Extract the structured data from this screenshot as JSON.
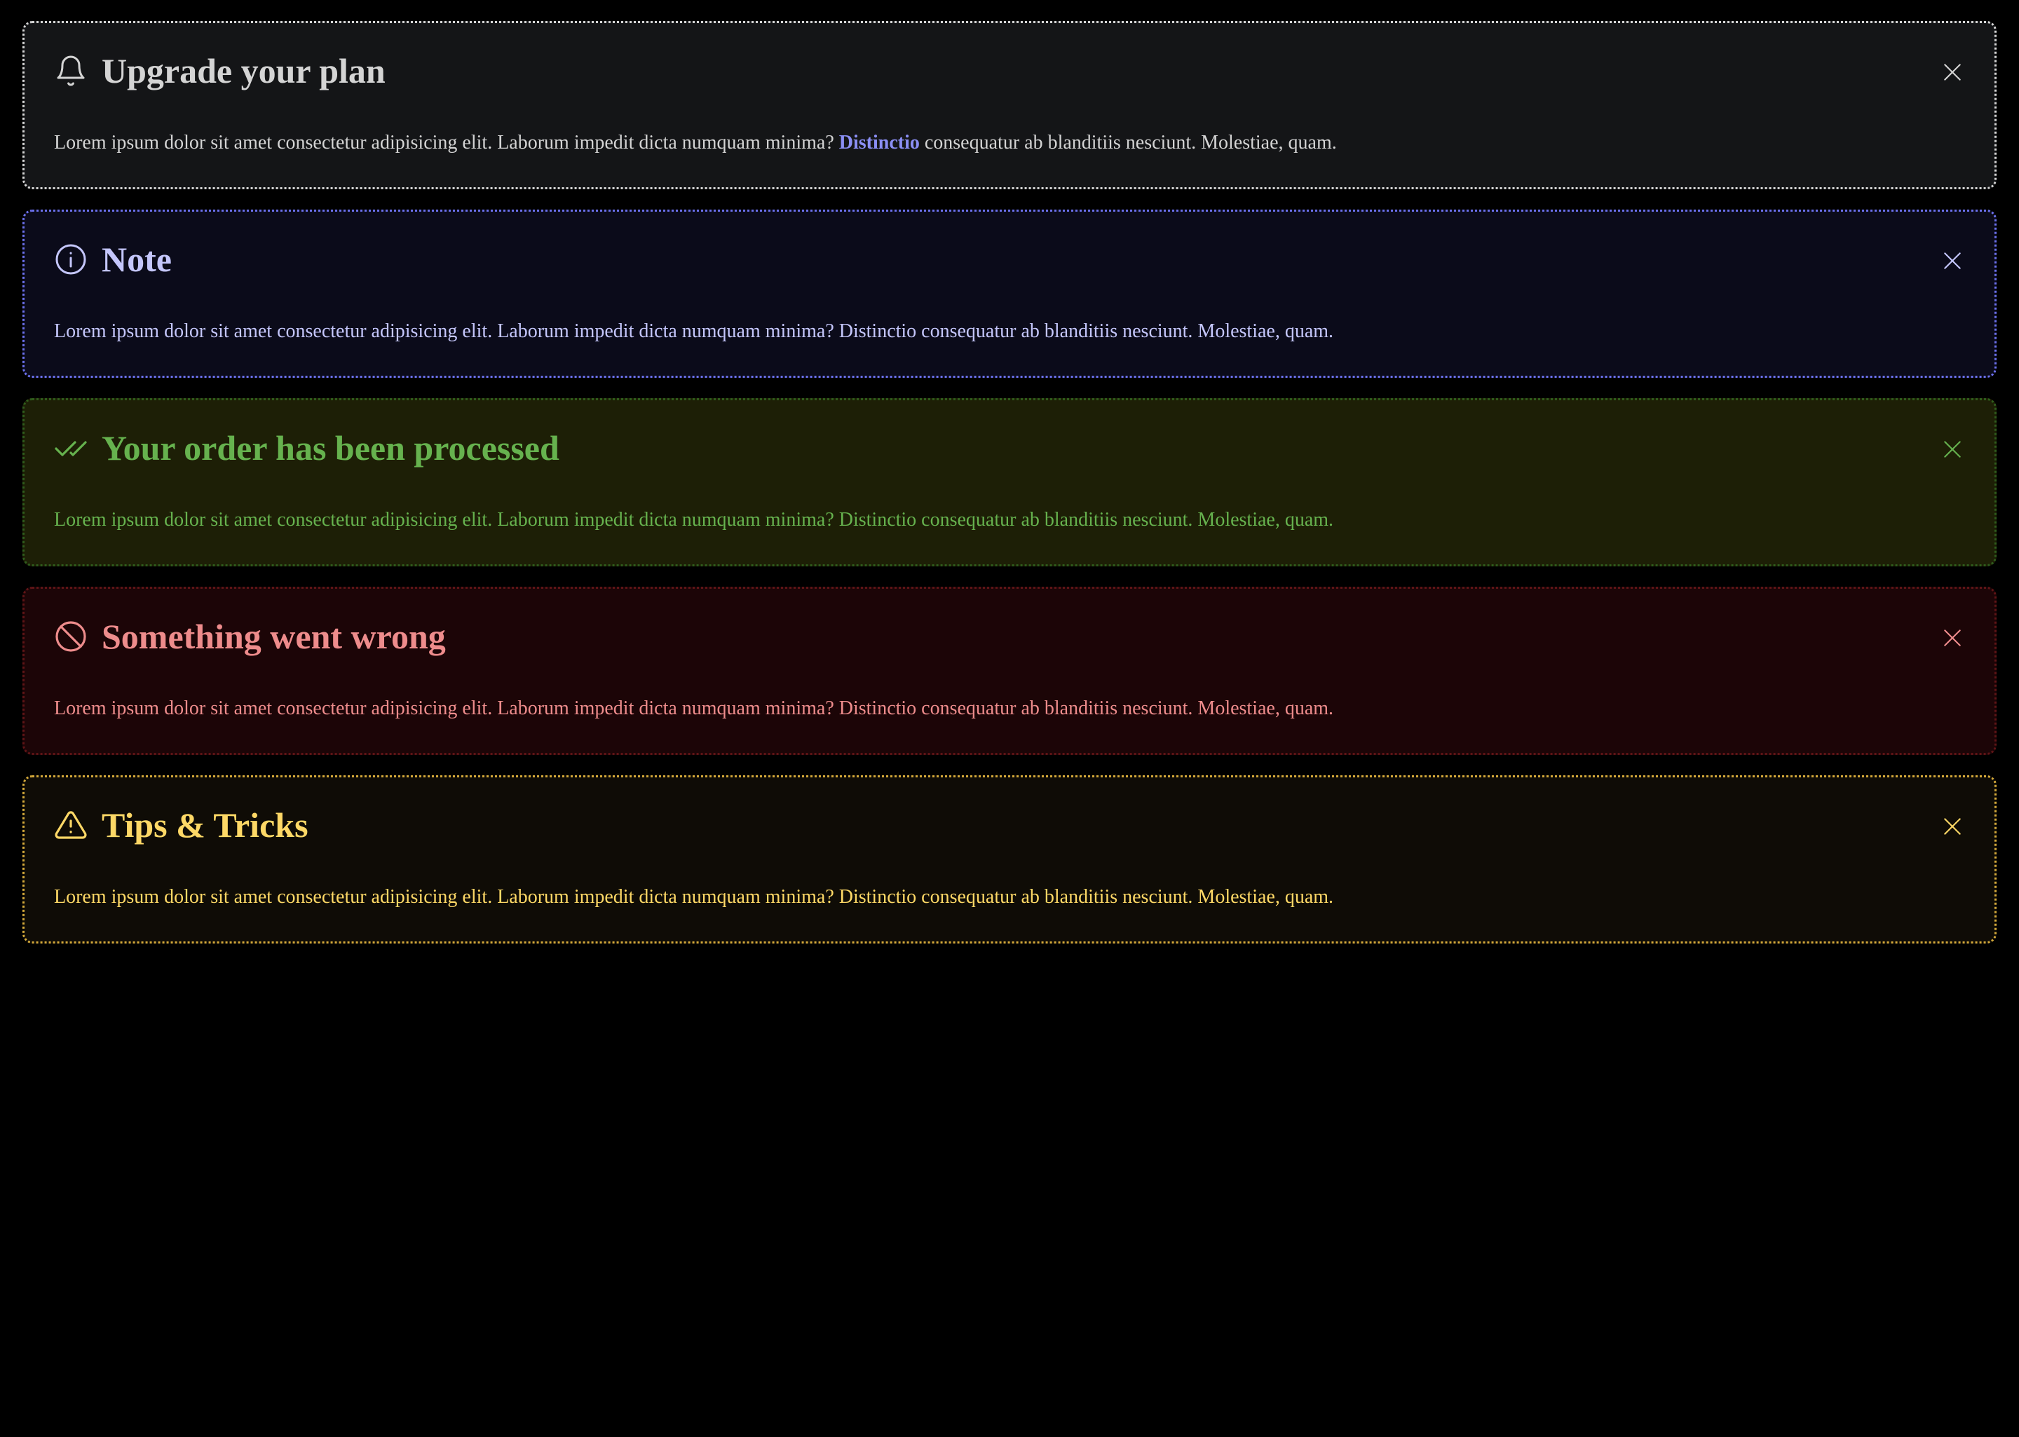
{
  "alerts": [
    {
      "variant": "neutral",
      "icon": "bell-icon",
      "title": "Upgrade your plan",
      "body_before": "Lorem ipsum dolor sit amet consectetur adipisicing elit. Laborum impedit dicta numquam minima?",
      "body_link": "Distinctio",
      "body_after": "consequatur ab blanditiis nesciunt. Molestiae, quam.",
      "text_color": "#d4d4d4",
      "link_color": "#8b8ff5"
    },
    {
      "variant": "info",
      "icon": "info-icon",
      "title": "Note",
      "body": "Lorem ipsum dolor sit amet consectetur adipisicing elit. Laborum impedit dicta numquam minima? Distinctio consequatur ab blanditiis nesciunt. Molestiae, quam.",
      "text_color": "#c4c6fb"
    },
    {
      "variant": "success",
      "icon": "double-check-icon",
      "title": "Your order has been processed",
      "body": "Lorem ipsum dolor sit amet consectetur adipisicing elit. Laborum impedit dicta numquam minima? Distinctio consequatur ab blanditiis nesciunt. Molestiae, quam.",
      "text_color": "#66b24e"
    },
    {
      "variant": "danger",
      "icon": "ban-icon",
      "title": "Something went wrong",
      "body": "Lorem ipsum dolor sit amet consectetur adipisicing elit. Laborum impedit dicta numquam minima? Distinctio consequatur ab blanditiis nesciunt. Molestiae, quam.",
      "text_color": "#ee8c8c"
    },
    {
      "variant": "warning",
      "icon": "warning-triangle-icon",
      "title": "Tips & Tricks",
      "body": "Lorem ipsum dolor sit amet consectetur adipisicing elit. Laborum impedit dicta numquam minima? Distinctio consequatur ab blanditiis nesciunt. Molestiae, quam.",
      "text_color": "#fdd866"
    }
  ],
  "close_icon": "close-icon",
  "page_background": "#000000"
}
